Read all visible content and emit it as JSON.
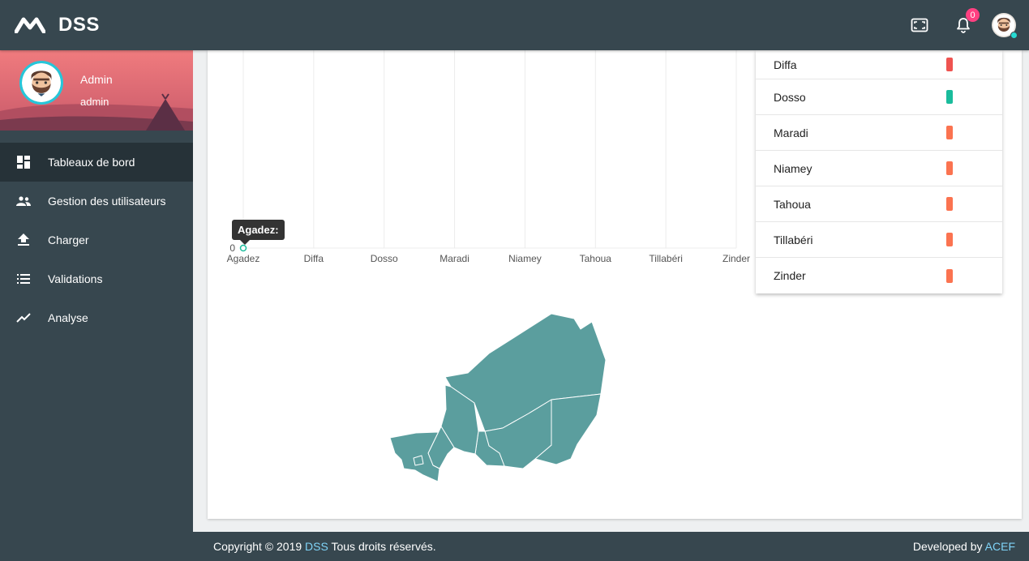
{
  "app": {
    "name": "DSS"
  },
  "topbar": {
    "notification_count": "0",
    "icons": [
      "fullscreen-icon",
      "bell-icon",
      "user-avatar"
    ]
  },
  "profile": {
    "name": "Admin",
    "role": "admin"
  },
  "sidebar": {
    "items": [
      {
        "label": "Tableaux de bord",
        "icon": "dashboard-icon",
        "active": true
      },
      {
        "label": "Gestion des utilisateurs",
        "icon": "users-icon",
        "active": false
      },
      {
        "label": "Charger",
        "icon": "upload-icon",
        "active": false
      },
      {
        "label": "Validations",
        "icon": "list-icon",
        "active": false
      },
      {
        "label": "Analyse",
        "icon": "trending-icon",
        "active": false
      }
    ]
  },
  "chart_data": {
    "type": "line",
    "categories": [
      "Agadez",
      "Diffa",
      "Dosso",
      "Maradi",
      "Niamey",
      "Tahoua",
      "Tillabéri",
      "Zinder"
    ],
    "values": [
      0
    ],
    "y_tick_labels": [
      "0"
    ],
    "tooltip": "Agadez:",
    "grid": "vertical"
  },
  "legend": {
    "items": [
      {
        "label": "Diffa",
        "color": "#ef5350"
      },
      {
        "label": "Dosso",
        "color": "#1abc9c"
      },
      {
        "label": "Maradi",
        "color": "#fb7350"
      },
      {
        "label": "Niamey",
        "color": "#fb7350"
      },
      {
        "label": "Tahoua",
        "color": "#fb7350"
      },
      {
        "label": "Tillabéri",
        "color": "#fb7350"
      },
      {
        "label": "Zinder",
        "color": "#fb7350"
      }
    ]
  },
  "map": {
    "fill_color": "#5b9e9e"
  },
  "footer": {
    "copyright_prefix": "Copyright © 2019",
    "brand": "DSS",
    "copyright_suffix": "Tous droits réservés.",
    "dev_prefix": "Developed by",
    "dev_name": "ACEF"
  }
}
